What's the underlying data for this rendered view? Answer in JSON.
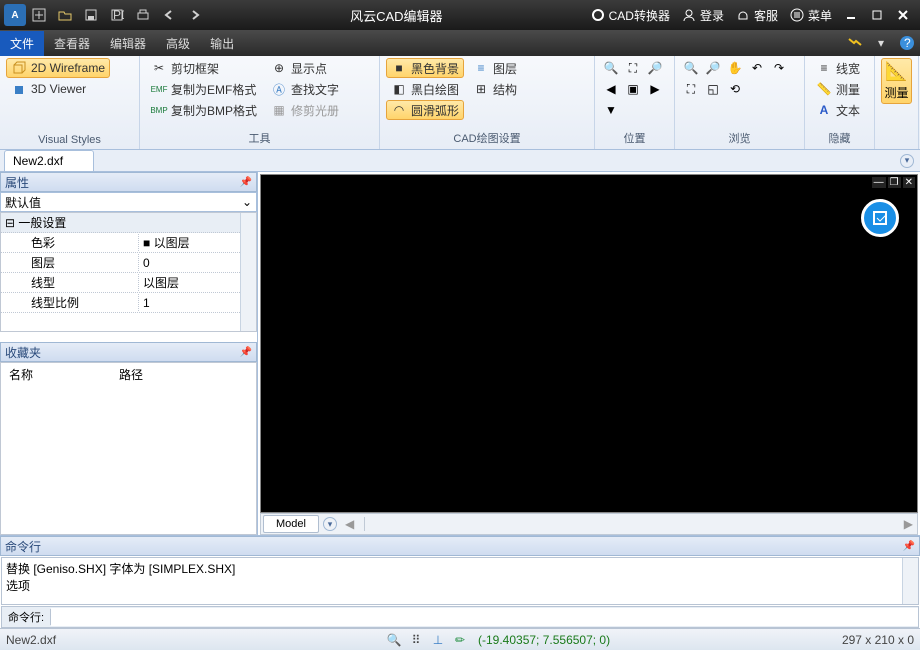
{
  "titlebar": {
    "app_title": "风云CAD编辑器",
    "cad_converter": "CAD转换器",
    "login": "登录",
    "service": "客服",
    "menu": "菜单"
  },
  "menubar": {
    "file": "文件",
    "viewer": "查看器",
    "editor": "编辑器",
    "advanced": "高级",
    "output": "输出"
  },
  "ribbon": {
    "vs": {
      "wf2d": "2D Wireframe",
      "v3d": "3D Viewer",
      "label": "Visual Styles"
    },
    "tools": {
      "clip": "剪切框架",
      "emf": "复制为EMF格式",
      "bmp": "复制为BMP格式",
      "show_pt": "显示点",
      "find": "查找文字",
      "trim": "修剪光册",
      "label": "工具"
    },
    "cad": {
      "black_bg": "黑色背景",
      "bw_draw": "黑白绘图",
      "arc": "圆滑弧形",
      "layer": "图层",
      "struct": "结构",
      "label": "CAD绘图设置"
    },
    "pos": {
      "label": "位置"
    },
    "browse": {
      "label": "浏览"
    },
    "hide": {
      "lw": "线宽",
      "meas": "测量",
      "text": "文本",
      "label": "隐藏"
    },
    "measure": {
      "label": "测量"
    }
  },
  "doc_tab": "New2.dxf",
  "props": {
    "title": "属性",
    "default": "默认值",
    "section": "一般设置",
    "rows": [
      {
        "k": "色彩",
        "v": "以图层"
      },
      {
        "k": "图层",
        "v": "0"
      },
      {
        "k": "线型",
        "v": "以图层"
      },
      {
        "k": "线型比例",
        "v": "1"
      }
    ]
  },
  "fav": {
    "title": "收藏夹",
    "col_name": "名称",
    "col_path": "路径"
  },
  "model_tab": "Model",
  "cmd": {
    "title": "命令行",
    "log1": "替换 [Geniso.SHX] 字体为 [SIMPLEX.SHX]",
    "log2": "选项",
    "label": "命令行:"
  },
  "status": {
    "file": "New2.dxf",
    "coords": "(-19.40357; 7.556507; 0)",
    "dims": "297 x 210 x 0"
  }
}
